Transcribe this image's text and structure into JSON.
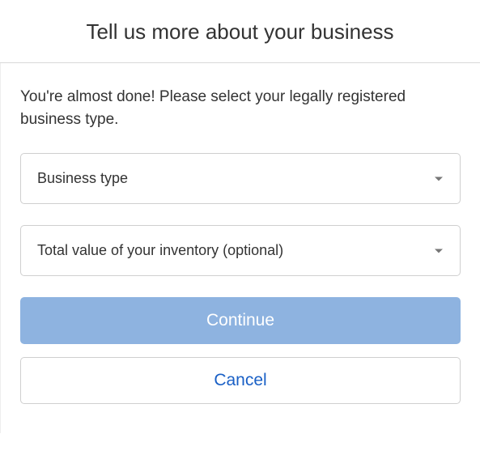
{
  "header": {
    "title": "Tell us more about your business"
  },
  "body": {
    "intro": "You're almost done! Please select your legally registered business type.",
    "business_type": {
      "placeholder": "Business type"
    },
    "inventory_value": {
      "placeholder": "Total value of your inventory (optional)"
    },
    "buttons": {
      "continue": "Continue",
      "cancel": "Cancel"
    }
  }
}
